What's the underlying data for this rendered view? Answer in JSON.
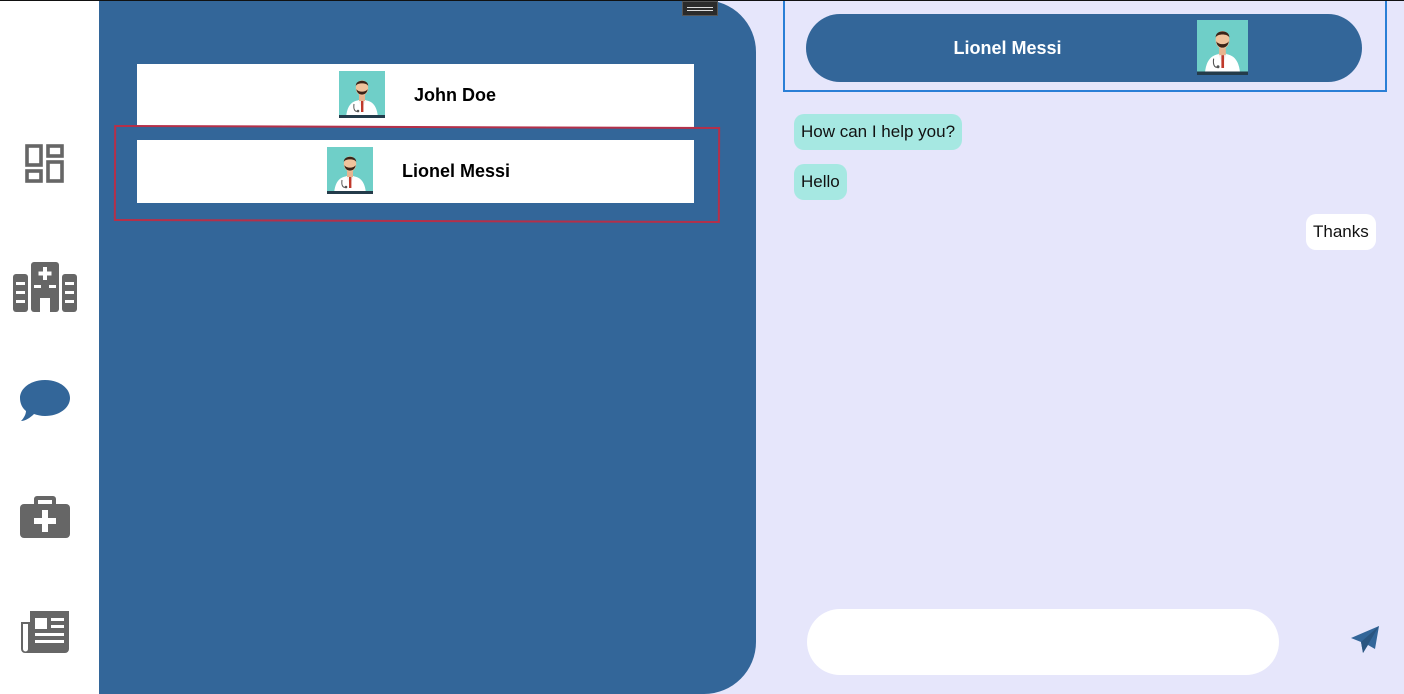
{
  "nav": {
    "items": [
      {
        "icon": "dashboard-icon"
      },
      {
        "icon": "hospital-icon"
      },
      {
        "icon": "chat-bubble-icon"
      },
      {
        "icon": "medical-kit-icon"
      },
      {
        "icon": "newspaper-icon"
      }
    ]
  },
  "contacts": [
    {
      "name": "John Doe",
      "avatar": "doctor-avatar"
    },
    {
      "name": "Lionel Messi",
      "avatar": "doctor-avatar",
      "selected": true
    }
  ],
  "chat": {
    "contact_name": "Lionel Messi",
    "messages": [
      {
        "text": "How can I help you?",
        "direction": "incoming"
      },
      {
        "text": "Hello",
        "direction": "incoming"
      },
      {
        "text": "Thanks",
        "direction": "outgoing"
      }
    ],
    "input_value": "",
    "send_icon": "send-plane-icon"
  },
  "colors": {
    "panel": "#336699",
    "chat_background": "#e6e6fb",
    "incoming_bubble": "#a6e8e2",
    "outgoing_bubble": "#ffffff",
    "nav_icon": "#666666",
    "active_nav_icon": "#336699"
  }
}
